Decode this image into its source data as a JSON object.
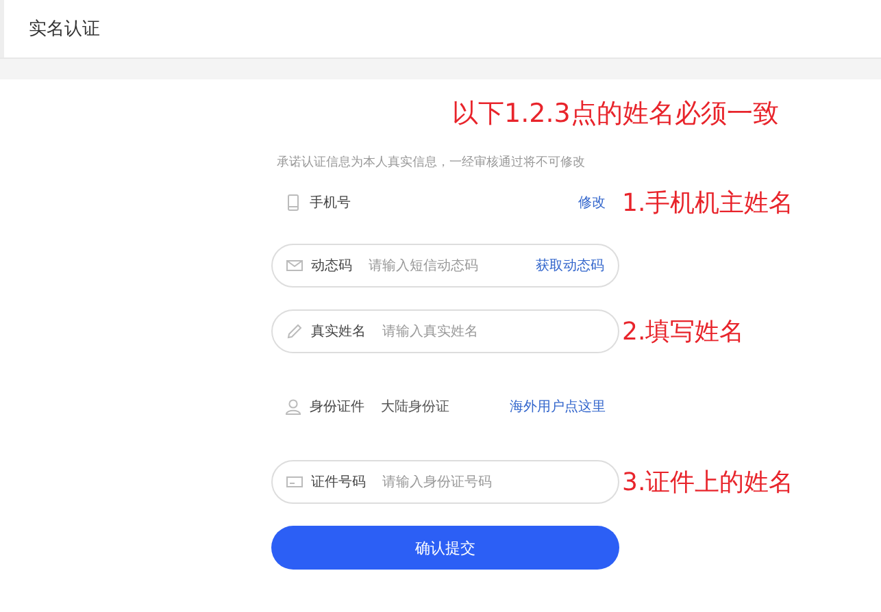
{
  "header": {
    "title": "实名认证"
  },
  "note_heading": "以下1.2.3点的姓名必须一致",
  "notice": "承诺认证信息为本人真实信息，一经审核通过将不可修改",
  "rows": [
    {
      "kind": "static",
      "label": "手机号",
      "link": "修改",
      "annotation": "1.手机机主姓名"
    },
    {
      "kind": "field",
      "label": "动态码",
      "placeholder": "请输入短信动态码",
      "link": "获取动态码"
    },
    {
      "kind": "field",
      "label": "真实姓名",
      "placeholder": "请输入真实姓名",
      "annotation": "2.填写姓名"
    },
    {
      "kind": "static",
      "label": "身份证件",
      "value": "大陆身份证",
      "link": "海外用户点这里"
    },
    {
      "kind": "field",
      "label": "证件号码",
      "placeholder": "请输入身份证号码",
      "annotation": "3.证件上的姓名"
    }
  ],
  "submit": "确认提交"
}
